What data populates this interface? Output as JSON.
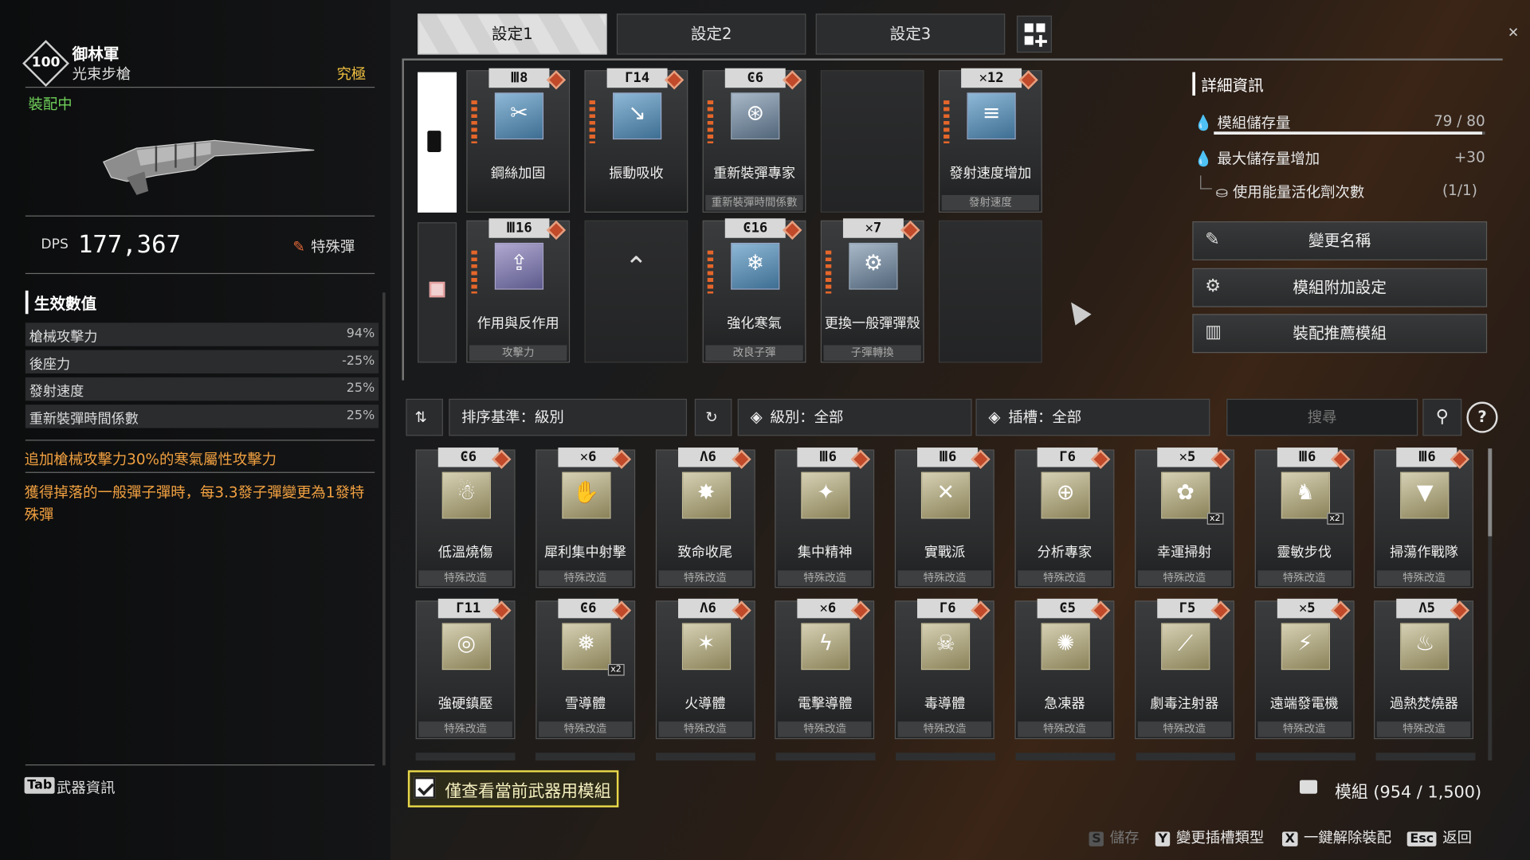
{
  "weapon": {
    "level": "100",
    "name": "御林軍",
    "type": "光束步槍",
    "rarity": "究極",
    "status": "裝配中",
    "dps_label": "DPS",
    "dps_value": "177,367",
    "ammo_label": "特殊彈"
  },
  "effects": {
    "heading": "生效數值",
    "rows": [
      {
        "label": "槍械攻擊力",
        "value": "94%"
      },
      {
        "label": "後座力",
        "value": "-25%"
      },
      {
        "label": "發射速度",
        "value": "25%"
      },
      {
        "label": "重新裝彈時間係數",
        "value": "25%"
      }
    ],
    "bonus1": "追加槍械攻擊力30%的寒氣屬性攻擊力",
    "bonus2": "獲得掉落的一般彈子彈時，每3.3發子彈變更為1發特殊彈"
  },
  "weapon_info_key": "Tab",
  "weapon_info_label": "武器資訊",
  "tabs": [
    "設定1",
    "設定2",
    "設定3"
  ],
  "equipped_row1": [
    {
      "cost": "Ⅲ8",
      "name": "鋼絲加固",
      "foot": "",
      "icon": "wire-icon",
      "color": "b"
    },
    {
      "cost": "Γ14",
      "name": "振動吸收",
      "foot": "",
      "icon": "vibration-icon",
      "color": "b"
    },
    {
      "cost": "Ͼ6",
      "name": "重新裝彈專家",
      "foot": "重新裝彈時間係數",
      "icon": "reload-icon",
      "color": "c"
    },
    {
      "empty": true
    },
    {
      "cost": "✕12",
      "name": "發射速度增加",
      "foot": "發射速度",
      "icon": "bullets-icon",
      "color": "b"
    }
  ],
  "equipped_row2": [
    {
      "cost": "Ⅲ16",
      "name": "作用與反作用",
      "foot": "攻擊力",
      "icon": "arrows-icon",
      "color": "p"
    },
    {
      "locked": true
    },
    {
      "cost": "Ͼ16",
      "name": "強化寒氣",
      "foot": "改良子彈",
      "icon": "cold-icon",
      "color": "b"
    },
    {
      "cost": "✕7",
      "name": "更換一般彈彈殼",
      "foot": "子彈轉換",
      "icon": "shell-icon",
      "color": "c"
    },
    {
      "empty": true
    }
  ],
  "info": {
    "heading": "詳細資訊",
    "capacity_label": "模組儲存量",
    "capacity_value": "79 / 80",
    "capacity_fill": 0.9875,
    "max_label": "最大儲存量增加",
    "max_value": "+30",
    "activator_label": "使用能量活化劑次數",
    "activator_value": "(1/1)",
    "btn_rename": "變更名稱",
    "btn_settings": "模組附加設定",
    "btn_recommend": "裝配推薦模組"
  },
  "filters": {
    "sort": "排序基準：級別",
    "level": "級別：全部",
    "slot": "插槽：全部",
    "search_placeholder": "搜尋"
  },
  "library_row1": [
    {
      "cost": "Ͼ6",
      "name": "低溫燒傷",
      "foot": "特殊改造",
      "icon": "freeze-icon"
    },
    {
      "cost": "✕6",
      "name": "犀利集中射擊",
      "foot": "特殊改造",
      "icon": "aim-hand-icon"
    },
    {
      "cost": "Λ6",
      "name": "致命收尾",
      "foot": "特殊改造",
      "icon": "burst-icon"
    },
    {
      "cost": "Ⅲ6",
      "name": "集中精神",
      "foot": "特殊改造",
      "icon": "focus-icon"
    },
    {
      "cost": "Ⅲ6",
      "name": "實戰派",
      "foot": "特殊改造",
      "icon": "cross-arrows-icon"
    },
    {
      "cost": "Γ6",
      "name": "分析專家",
      "foot": "特殊改造",
      "icon": "target-icon"
    },
    {
      "cost": "✕5",
      "name": "幸運掃射",
      "foot": "特殊改造",
      "icon": "gear-icon",
      "x2": "x2"
    },
    {
      "cost": "Ⅲ6",
      "name": "靈敏步伐",
      "foot": "特殊改造",
      "icon": "boot-icon",
      "x2": "x2"
    },
    {
      "cost": "Ⅲ6",
      "name": "掃蕩作戰隊",
      "foot": "特殊改造",
      "icon": "shield-icon"
    }
  ],
  "library_row2": [
    {
      "cost": "Γ11",
      "name": "強硬鎮壓",
      "foot": "特殊改造",
      "icon": "crosshair-icon"
    },
    {
      "cost": "Ͼ6",
      "name": "雪導體",
      "foot": "特殊改造",
      "icon": "snow-icon",
      "x2": "x2"
    },
    {
      "cost": "Λ6",
      "name": "火導體",
      "foot": "特殊改造",
      "icon": "fire-icon"
    },
    {
      "cost": "✕6",
      "name": "電擊導體",
      "foot": "特殊改造",
      "icon": "lightning-icon"
    },
    {
      "cost": "Γ6",
      "name": "毒導體",
      "foot": "特殊改造",
      "icon": "skull-icon"
    },
    {
      "cost": "Ͼ5",
      "name": "急凍器",
      "foot": "特殊改造",
      "icon": "frost-gear-icon"
    },
    {
      "cost": "Γ5",
      "name": "劇毒注射器",
      "foot": "特殊改造",
      "icon": "syringe-icon"
    },
    {
      "cost": "✕5",
      "name": "遠端發電機",
      "foot": "特殊改造",
      "icon": "spark-icon"
    },
    {
      "cost": "Λ5",
      "name": "過熱焚燒器",
      "foot": "特殊改造",
      "icon": "flame-icon"
    }
  ],
  "only_current_label": "僅查看當前武器用模組",
  "mod_count_label": "模組 (954 / 1,500)",
  "hints": {
    "save_key": "S",
    "save": "儲存",
    "slot_key": "Y",
    "slot": "變更插槽類型",
    "unequip_key": "X",
    "unequip": "一鍵解除裝配",
    "back_key": "Esc",
    "back": "返回"
  },
  "colors": {
    "accent": "#e5662a",
    "equipped": "#6fd05a",
    "highlight": "#e8d84a",
    "rarity": "#f0c040"
  }
}
